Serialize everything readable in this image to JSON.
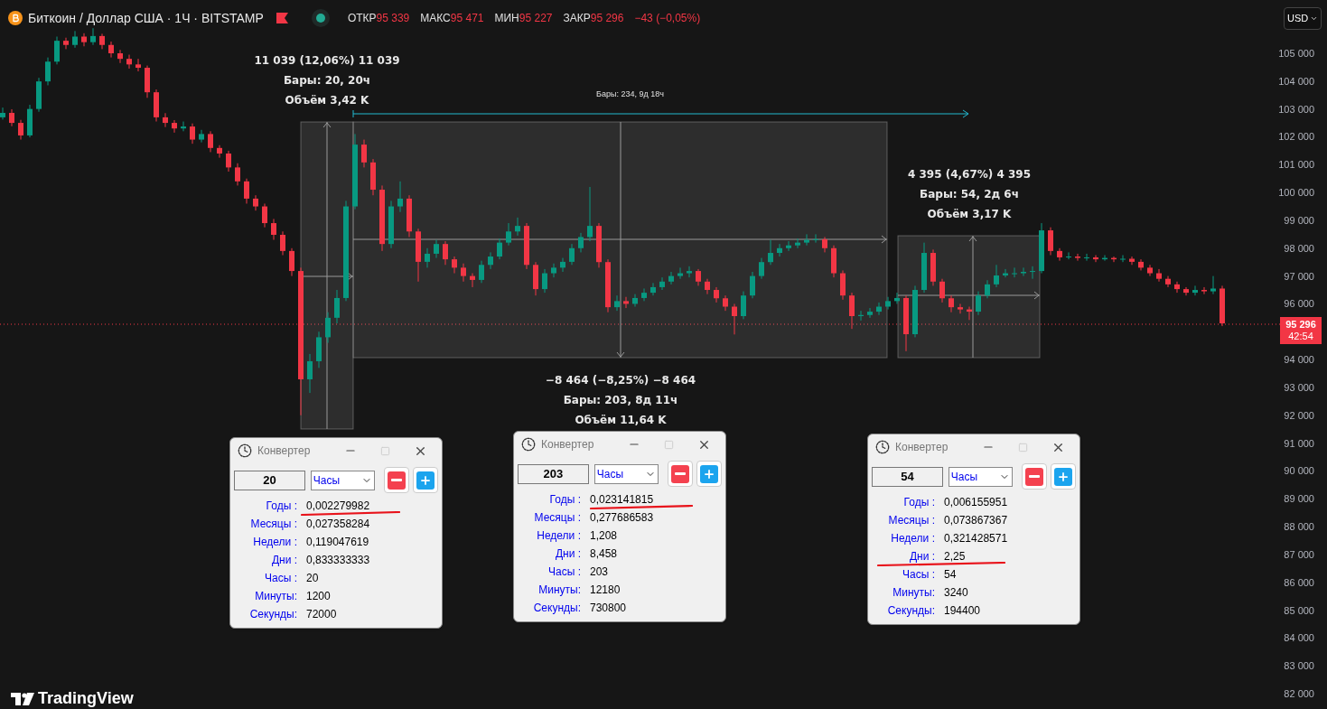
{
  "header": {
    "symbol_title": "Биткоин / Доллар США · 1Ч · BITSTAMP",
    "market_open": true,
    "ohlc": [
      {
        "label": "ОТКР",
        "value": "95 339"
      },
      {
        "label": "МАКС",
        "value": "95 471"
      },
      {
        "label": "МИН",
        "value": "95 227"
      },
      {
        "label": "ЗАКР",
        "value": "95 296"
      }
    ],
    "change": "−43 (−0,05%)"
  },
  "currency_select": {
    "value": "USD"
  },
  "price_chart": {
    "chart_data": {
      "type": "candlestick",
      "ylim": [
        82000,
        105000
      ],
      "categories": [
        null,
        null,
        null,
        null,
        null,
        null,
        null,
        null,
        null,
        null,
        null,
        null,
        null,
        null,
        null,
        null,
        null,
        null,
        null,
        null,
        null,
        null,
        null,
        null,
        null,
        null,
        null,
        null,
        null,
        null,
        null,
        null,
        null,
        null,
        null,
        null,
        null,
        null,
        null,
        null,
        null,
        null,
        null,
        null,
        null,
        null,
        null,
        null,
        null,
        null,
        null,
        null,
        null,
        null,
        null,
        null,
        null,
        null,
        null,
        null,
        null,
        null,
        null,
        null,
        null,
        null,
        null,
        null,
        null,
        null,
        null,
        null,
        null,
        null,
        null,
        null,
        null,
        null,
        null,
        null,
        null,
        null,
        null,
        null,
        null,
        null,
        null,
        null,
        null,
        null,
        null,
        null,
        null,
        null,
        null,
        null,
        null,
        null,
        null,
        null,
        null,
        null,
        null,
        null,
        null,
        null,
        null,
        null,
        null,
        null,
        null,
        null,
        null,
        null,
        null,
        null,
        null,
        null,
        null,
        null,
        null,
        null,
        null,
        null,
        null,
        null,
        null,
        null,
        null,
        null,
        null,
        null,
        null,
        null,
        null,
        null
      ],
      "yticks": [
        {
          "value": 105000,
          "label": "105 000"
        },
        {
          "value": 104000,
          "label": "104 000"
        },
        {
          "value": 103000,
          "label": "103 000"
        },
        {
          "value": 102000,
          "label": "102 000"
        },
        {
          "value": 101000,
          "label": "101 000"
        },
        {
          "value": 100000,
          "label": "100 000"
        },
        {
          "value": 99000,
          "label": "99 000"
        },
        {
          "value": 98000,
          "label": "98 000"
        },
        {
          "value": 97000,
          "label": "97 000"
        },
        {
          "value": 96000,
          "label": "96 000"
        },
        {
          "value": 94000,
          "label": "94 000"
        },
        {
          "value": 93000,
          "label": "93 000"
        },
        {
          "value": 92000,
          "label": "92 000"
        },
        {
          "value": 91000,
          "label": "91 000"
        },
        {
          "value": 90000,
          "label": "90 000"
        },
        {
          "value": 89000,
          "label": "89 000"
        },
        {
          "value": 88000,
          "label": "88 000"
        },
        {
          "value": 87000,
          "label": "87 000"
        },
        {
          "value": 86000,
          "label": "86 000"
        },
        {
          "value": 85000,
          "label": "85 000"
        },
        {
          "value": 84000,
          "label": "84 000"
        },
        {
          "value": 83000,
          "label": "83 000"
        },
        {
          "value": 82000,
          "label": "82 000"
        }
      ],
      "ohlc": [
        [
          102700,
          103050,
          102620,
          102860
        ],
        [
          102860,
          102990,
          102380,
          102500
        ],
        [
          102500,
          102610,
          101900,
          102050
        ],
        [
          102050,
          103150,
          101980,
          103000
        ],
        [
          103000,
          104120,
          102900,
          103990
        ],
        [
          103990,
          104850,
          103850,
          104700
        ],
        [
          104700,
          105600,
          104600,
          105450
        ],
        [
          105450,
          105560,
          105150,
          105300
        ],
        [
          105300,
          105800,
          105200,
          105600
        ],
        [
          105600,
          105720,
          105250,
          105400
        ],
        [
          105400,
          105900,
          105300,
          105620
        ],
        [
          105620,
          105700,
          105150,
          105300
        ],
        [
          105300,
          105420,
          104850,
          105000
        ],
        [
          105000,
          105120,
          104650,
          104800
        ],
        [
          104800,
          104950,
          104450,
          104600
        ],
        [
          104600,
          104800,
          104350,
          104480
        ],
        [
          104480,
          104560,
          103400,
          103600
        ],
        [
          103600,
          103700,
          102550,
          102700
        ],
        [
          102700,
          102850,
          102350,
          102500
        ],
        [
          102500,
          102600,
          102150,
          102300
        ],
        [
          102300,
          102550,
          102200,
          102370
        ],
        [
          102370,
          102480,
          101750,
          101900
        ],
        [
          101900,
          102250,
          101800,
          102100
        ],
        [
          102100,
          102200,
          101450,
          101600
        ],
        [
          101600,
          101700,
          101250,
          101400
        ],
        [
          101400,
          101500,
          100750,
          100900
        ],
        [
          100900,
          101050,
          100250,
          100400
        ],
        [
          100400,
          100500,
          99600,
          99780
        ],
        [
          99780,
          99900,
          99350,
          99500
        ],
        [
          99500,
          99600,
          98750,
          98900
        ],
        [
          98900,
          99050,
          98300,
          98480
        ],
        [
          98480,
          98600,
          97750,
          97900
        ],
        [
          97900,
          98000,
          97000,
          97180
        ],
        [
          97180,
          97300,
          92000,
          93290
        ],
        [
          93290,
          94200,
          92800,
          93940
        ],
        [
          93940,
          95000,
          93700,
          94800
        ],
        [
          94800,
          95700,
          94600,
          95500
        ],
        [
          95500,
          96500,
          95300,
          96210
        ],
        [
          96210,
          99700,
          96100,
          99500
        ],
        [
          99500,
          102100,
          99400,
          101720
        ],
        [
          101720,
          101900,
          100900,
          101080
        ],
        [
          101080,
          101200,
          99900,
          100100
        ],
        [
          100100,
          100250,
          97900,
          98150
        ],
        [
          98150,
          99700,
          98000,
          99500
        ],
        [
          99500,
          100400,
          99300,
          99780
        ],
        [
          99780,
          99900,
          98400,
          98600
        ],
        [
          98600,
          98700,
          96800,
          97510
        ],
        [
          97510,
          98000,
          97300,
          97800
        ],
        [
          97800,
          98300,
          97650,
          98150
        ],
        [
          98150,
          98250,
          97400,
          97600
        ],
        [
          97600,
          97700,
          97100,
          97300
        ],
        [
          97300,
          97450,
          96800,
          97000
        ],
        [
          97000,
          97100,
          96600,
          96860
        ],
        [
          96860,
          97550,
          96750,
          97400
        ],
        [
          97400,
          97850,
          97250,
          97700
        ],
        [
          97700,
          98350,
          97600,
          98200
        ],
        [
          98200,
          98900,
          98100,
          98600
        ],
        [
          98600,
          99100,
          98450,
          98800
        ],
        [
          98800,
          98900,
          97250,
          97400
        ],
        [
          97400,
          97500,
          96300,
          96530
        ],
        [
          96530,
          97250,
          96400,
          97100
        ],
        [
          97100,
          97450,
          96950,
          97300
        ],
        [
          97300,
          97650,
          97150,
          97510
        ],
        [
          97510,
          98150,
          97400,
          98000
        ],
        [
          98000,
          98550,
          97850,
          98400
        ],
        [
          98400,
          100200,
          98250,
          98800
        ],
        [
          98800,
          98900,
          97300,
          97500
        ],
        [
          97500,
          97600,
          95700,
          95880
        ],
        [
          95880,
          96300,
          95750,
          96100
        ],
        [
          96100,
          96250,
          95850,
          96000
        ],
        [
          96000,
          96350,
          95900,
          96210
        ],
        [
          96210,
          96550,
          96100,
          96400
        ],
        [
          96400,
          96750,
          96300,
          96600
        ],
        [
          96600,
          96950,
          96500,
          96800
        ],
        [
          96800,
          97150,
          96700,
          97000
        ],
        [
          97000,
          97300,
          96900,
          97100
        ],
        [
          97100,
          97350,
          96950,
          97180
        ],
        [
          97180,
          97250,
          96650,
          96800
        ],
        [
          96800,
          96900,
          96350,
          96500
        ],
        [
          96500,
          96600,
          96050,
          96200
        ],
        [
          96200,
          96300,
          95750,
          95900
        ],
        [
          95900,
          96000,
          94900,
          95560
        ],
        [
          95560,
          96450,
          95450,
          96300
        ],
        [
          96300,
          97150,
          96200,
          97000
        ],
        [
          97000,
          97650,
          96900,
          97500
        ],
        [
          97500,
          98300,
          97400,
          97830
        ],
        [
          97830,
          98150,
          97700,
          98000
        ],
        [
          98000,
          98250,
          97900,
          98100
        ],
        [
          98100,
          98350,
          98000,
          98200
        ],
        [
          98200,
          98500,
          98100,
          98300
        ],
        [
          98300,
          98500,
          98200,
          98320
        ],
        [
          98320,
          98400,
          97850,
          98000
        ],
        [
          98000,
          98100,
          96950,
          97100
        ],
        [
          97100,
          97200,
          96150,
          96300
        ],
        [
          96300,
          96400,
          95100,
          95560
        ],
        [
          95560,
          95750,
          95400,
          95600
        ],
        [
          95600,
          95850,
          95500,
          95720
        ],
        [
          95720,
          96050,
          95600,
          95900
        ],
        [
          95900,
          96250,
          95800,
          96100
        ],
        [
          96100,
          96400,
          96000,
          96210
        ],
        [
          96210,
          96300,
          94300,
          94910
        ],
        [
          94910,
          96650,
          94800,
          96500
        ],
        [
          96500,
          98200,
          96400,
          97830
        ],
        [
          97830,
          97950,
          96650,
          96800
        ],
        [
          96800,
          96900,
          96050,
          96200
        ],
        [
          96200,
          96300,
          95700,
          95880
        ],
        [
          95880,
          96000,
          95650,
          95800
        ],
        [
          95800,
          95900,
          95420,
          95720
        ],
        [
          95720,
          96450,
          95600,
          96300
        ],
        [
          96300,
          96850,
          96200,
          96700
        ],
        [
          96700,
          97400,
          96600,
          97020
        ],
        [
          97020,
          97250,
          96950,
          97100
        ],
        [
          97100,
          97300,
          96950,
          97100
        ],
        [
          97100,
          97300,
          97000,
          97150
        ],
        [
          97150,
          97350,
          96900,
          97180
        ],
        [
          97180,
          98900,
          97100,
          98640
        ],
        [
          98640,
          98750,
          97750,
          97900
        ],
        [
          97900,
          98000,
          97550,
          97670
        ],
        [
          97670,
          97850,
          97600,
          97700
        ],
        [
          97700,
          97800,
          97550,
          97650
        ],
        [
          97650,
          97800,
          97550,
          97670
        ],
        [
          97670,
          97750,
          97500,
          97600
        ],
        [
          97600,
          97750,
          97550,
          97650
        ],
        [
          97650,
          97700,
          97500,
          97600
        ],
        [
          97600,
          97750,
          97500,
          97620
        ],
        [
          97620,
          97700,
          97400,
          97510
        ],
        [
          97510,
          97600,
          97200,
          97300
        ],
        [
          97300,
          97400,
          97000,
          97100
        ],
        [
          97100,
          97250,
          96800,
          96900
        ],
        [
          96900,
          97000,
          96600,
          96700
        ],
        [
          96700,
          96800,
          96400,
          96530
        ],
        [
          96530,
          96600,
          96300,
          96400
        ],
        [
          96400,
          96650,
          96300,
          96500
        ],
        [
          96500,
          96600,
          96350,
          96450
        ],
        [
          96450,
          97000,
          96350,
          96550
        ],
        [
          96550,
          96650,
          95200,
          95300
        ]
      ]
    }
  },
  "price_axis": {
    "last_price": "95 296",
    "countdown": "42:54"
  },
  "measurements": [
    {
      "rising": true,
      "lines": [
        "11 039 (12,06%) 11 039",
        "Бары: 20, 20ч",
        "Объём 3,42 K"
      ]
    },
    {
      "rising": false,
      "lines": [
        "−8 464 (−8,25%) −8 464",
        "Бары: 203, 8д 11ч",
        "Объём 11,64 K"
      ]
    },
    {
      "rising": true,
      "lines": [
        "4 395 (4,67%) 4 395",
        "Бары: 54, 2д 6ч",
        "Объём 3,17 K"
      ]
    }
  ],
  "range_label": "Бары: 234, 9д 18ч",
  "converters": [
    {
      "title": "Конвертер",
      "value": "20",
      "unit": "Часы",
      "rows": [
        {
          "label": "Годы :",
          "value": "0,002279982",
          "underlined": true
        },
        {
          "label": "Месяцы :",
          "value": "0,027358284",
          "underlined": false
        },
        {
          "label": "Недели :",
          "value": "0,119047619",
          "underlined": false
        },
        {
          "label": "Дни :",
          "value": "0,833333333",
          "underlined": false
        },
        {
          "label": "Часы :",
          "value": "20",
          "underlined": false
        },
        {
          "label": "Минуты:",
          "value": "1200",
          "underlined": false
        },
        {
          "label": "Секунды:",
          "value": "72000",
          "underlined": false
        }
      ]
    },
    {
      "title": "Конвертер",
      "value": "203",
      "unit": "Часы",
      "rows": [
        {
          "label": "Годы :",
          "value": "0,023141815",
          "underlined": true
        },
        {
          "label": "Месяцы :",
          "value": "0,277686583",
          "underlined": false
        },
        {
          "label": "Недели :",
          "value": "1,208",
          "underlined": false
        },
        {
          "label": "Дни :",
          "value": "8,458",
          "underlined": false
        },
        {
          "label": "Часы :",
          "value": "203",
          "underlined": false
        },
        {
          "label": "Минуты:",
          "value": "12180",
          "underlined": false
        },
        {
          "label": "Секунды:",
          "value": "730800",
          "underlined": false
        }
      ]
    },
    {
      "title": "Конвертер",
      "value": "54",
      "unit": "Часы",
      "rows": [
        {
          "label": "Годы :",
          "value": "0,006155951",
          "underlined": false
        },
        {
          "label": "Месяцы :",
          "value": "0,073867367",
          "underlined": false
        },
        {
          "label": "Недели :",
          "value": "0,321428571",
          "underlined": false
        },
        {
          "label": "Дни :",
          "value": "2,25",
          "underlined": true
        },
        {
          "label": "Часы :",
          "value": "54",
          "underlined": false
        },
        {
          "label": "Минуты:",
          "value": "3240",
          "underlined": false
        },
        {
          "label": "Секунды:",
          "value": "194400",
          "underlined": false
        }
      ]
    }
  ],
  "logo": "TradingView"
}
